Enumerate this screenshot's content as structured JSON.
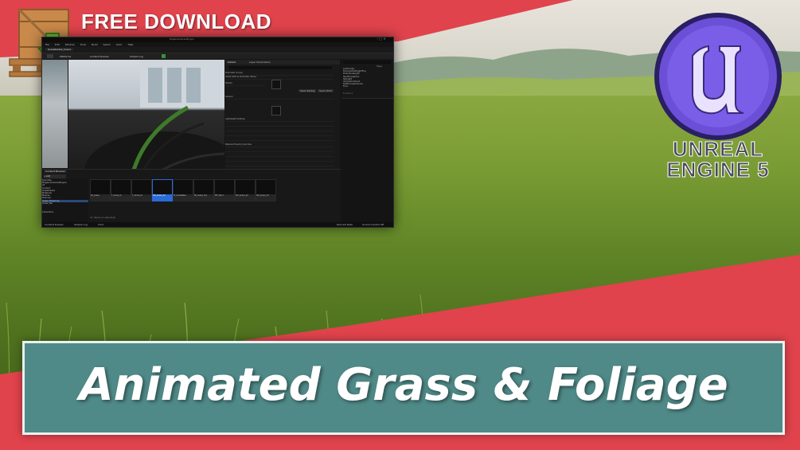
{
  "banner": {
    "free_download": "FREE DOWNLOAD"
  },
  "brand": {
    "line1": "UNREAL",
    "line2": "ENGINE 5"
  },
  "title": "Animated Grass & Foliage",
  "editor": {
    "window_title": "MegascansGrassEngine",
    "menu": [
      "File",
      "Edit",
      "Window",
      "Tools",
      "Build",
      "Select",
      "Actor",
      "Help"
    ],
    "level_tab": "Grassblades_Scene",
    "toolbar": [
      "Platforms",
      "Content Drawer",
      "Output Log",
      "Cmd"
    ],
    "details_tabs": [
      "Details",
      "Layer Parameters"
    ],
    "details_sections": [
      "Parameter Groups",
      "Global Texture Parameter Values",
      "Texture",
      "General",
      "Lightweight Settings",
      "Material Property Overrides",
      "Advanced",
      "Previewing"
    ],
    "details_buttons": [
      "Save Sibling",
      "Save Child"
    ],
    "outliner_header": "Type",
    "outliner_items": [
      "Landscape",
      "ExponentialHeightFog",
      "DirectionalLight",
      "SkyAtmosphere",
      "SkyLight",
      "VolumetricCloud",
      "PostProcessVolume",
      "Floor"
    ],
    "outliner_status": "8 actors",
    "content_browser_tab": "Content Browser",
    "folder_tree": [
      "Favorites",
      "MegascansGrassEngine",
      "All",
      "Content",
      "Grassblades",
      "Materials",
      "Meshes",
      "Textures",
      "Grass_Flowering",
      "Grass_Tall",
      "Collections"
    ],
    "assets": [
      "MI_Grass",
      "T_Grass_D",
      "T_Grass_N",
      "SM_Grass_01",
      "M_GrassBase",
      "MI_Grass_Dry",
      "MF_Wind",
      "SM_Grass_02",
      "SM_Grass_03",
      "BP_Foliage",
      "M_Foliage"
    ],
    "assets_count": "11 items (1 selected)",
    "status_bar": [
      "Content Drawer",
      "Output Log",
      "Cmd",
      "Derived Data",
      "Source Control Off"
    ]
  },
  "colors": {
    "banner_red": "#e0434c",
    "title_box": "#4f8a88",
    "ue_ring": "#6b4fd6"
  },
  "icons": {
    "download": "crate-download-icon",
    "logo": "unreal-logo-icon"
  }
}
